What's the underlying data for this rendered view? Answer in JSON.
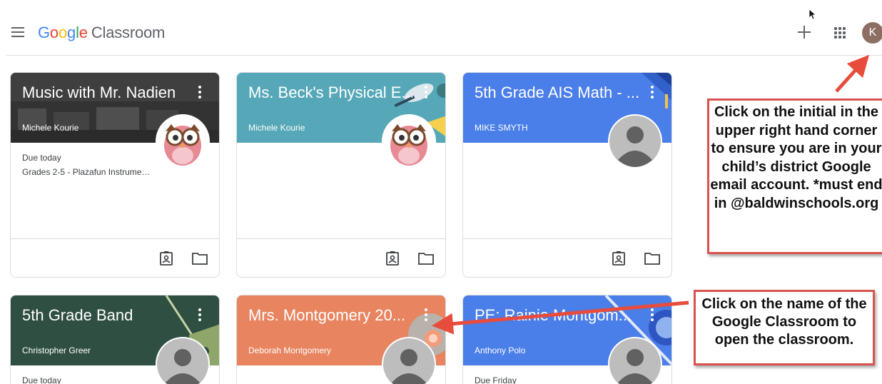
{
  "app": {
    "logo_letters": [
      "G",
      "o",
      "o",
      "g",
      "l",
      "e"
    ],
    "product_name": "Classroom",
    "avatar_initial": "K"
  },
  "icons": {
    "menu": "hamburger-menu-icon",
    "create": "plus-icon",
    "apps": "apps-grid-icon",
    "portfolio": "portfolio-icon",
    "folder": "folder-icon",
    "more": "more-vert-icon"
  },
  "colors": {
    "music": "#3b3b3b",
    "physical_ed": "#56a8b8",
    "math": "#4a7ee8",
    "band": "#2f4f42",
    "montgomery": "#e8845f",
    "pe_polo": "#4a7ee8",
    "callout_border": "#d9534f",
    "arrow": "#e74c3c"
  },
  "classes": [
    {
      "title": "Music with Mr. Nadien",
      "teacher": "Michele Kourie",
      "due_label": "Due today",
      "due_item": "Grades 2-5 - Plazafun Instrume…",
      "avatar": "owl"
    },
    {
      "title": "Ms. Beck's Physical E...",
      "teacher": "Michele Kourie",
      "due_label": "",
      "due_item": "",
      "avatar": "owl"
    },
    {
      "title": "5th Grade AIS Math - ...",
      "teacher": "MIKE SMYTH",
      "due_label": "",
      "due_item": "",
      "avatar": "person"
    },
    {
      "title": "5th Grade Band",
      "teacher": "Christopher Greer",
      "due_label": "Due today",
      "due_item": "",
      "avatar": "person"
    },
    {
      "title": "Mrs. Montgomery 20...",
      "teacher": "Deborah Montgomery",
      "due_label": "",
      "due_item": "",
      "avatar": "person"
    },
    {
      "title": "PE: Rainie Montgom...",
      "teacher": "Anthony Polo",
      "due_label": "Due Friday",
      "due_item": "",
      "avatar": "person"
    }
  ],
  "callouts": {
    "account": "Click on the initial in the upper right hand corner to ensure you are in your child’s district Google email account. *must end in @baldwinschools.org",
    "open_class": "Click on the name of the Google Classroom to open the classroom."
  }
}
